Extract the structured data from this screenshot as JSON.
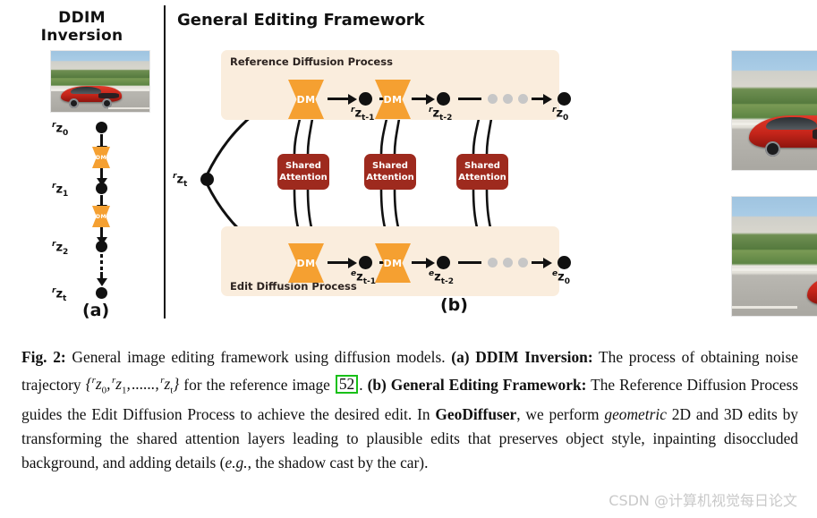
{
  "figure": {
    "panel_a": {
      "title_line1": "DDIM",
      "title_line2": "Inversion",
      "letter": "(a)",
      "dm_label": "DM",
      "nodes": [
        {
          "pre": "r",
          "base": "z",
          "sub": "0"
        },
        {
          "pre": "r",
          "base": "z",
          "sub": "1"
        },
        {
          "pre": "r",
          "base": "z",
          "sub": "2"
        },
        {
          "pre": "r",
          "base": "z",
          "sub": "t"
        }
      ]
    },
    "panel_b": {
      "title": "General Editing Framework",
      "letter": "(b)",
      "reference_band_label": "Reference Diffusion Process",
      "edit_band_label": "Edit Diffusion Process",
      "dm_label": "DM",
      "branch_node": {
        "pre": "r",
        "base": "z",
        "sub": "t"
      },
      "shared_attention": [
        {
          "line1": "Shared",
          "line2": "Attention"
        },
        {
          "line1": "Shared",
          "line2": "Attention"
        },
        {
          "line1": "Shared",
          "line2": "Attention"
        }
      ],
      "reference_nodes": [
        {
          "pre": "r",
          "base": "z",
          "sub": "t-1"
        },
        {
          "pre": "r",
          "base": "z",
          "sub": "t-2"
        },
        {
          "pre": "r",
          "base": "z",
          "sub": "0"
        }
      ],
      "edit_nodes": [
        {
          "pre": "e",
          "base": "z",
          "sub": "t-1"
        },
        {
          "pre": "e",
          "base": "z",
          "sub": "t-2"
        },
        {
          "pre": "e",
          "base": "z",
          "sub": "0"
        }
      ]
    },
    "colors": {
      "dm_orange": "#f5a031",
      "shared_attention_red": "#9e2a1e",
      "band_beige": "#faeddd",
      "node_black": "#111111",
      "ellipsis_gray": "#c7c7c7",
      "citation_green": "#18c018"
    }
  },
  "caption": {
    "label": "Fig. 2:",
    "t1": " General image editing framework using diffusion models. ",
    "b1": "(a) DDIM Inversion:",
    "t2": " The process of obtaining noise trajectory ",
    "math": "{ r z0, r z1, ......, r zt }",
    "t3": " for the reference image ",
    "citation": "52",
    "t4": ". ",
    "b2": "(b) General Editing Framework:",
    "t5": " The Reference Diffusion Process guides the Edit Diffusion Process to achieve the desired edit. In ",
    "b3": "GeoDiffuser",
    "t6": ", we perform ",
    "i1": "geometric",
    "t7": " 2D and 3D edits by transforming the shared attention layers leading to plausible edits that preserves object style, inpainting disoccluded background, and adding details (",
    "i2": "e.g.",
    "t8": ",  the shadow cast by the car)."
  },
  "watermark": "CSDN @计算机视觉每日论文"
}
